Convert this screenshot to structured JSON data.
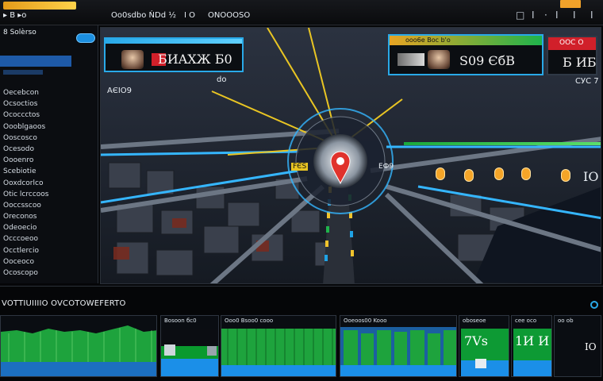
{
  "topbar": {
    "items": [
      "▸ B  ▸o",
      " ",
      "Oo0sdbo ŃDd ½",
      "I O",
      "ONOOOSO"
    ],
    "right_icons": [
      "□",
      "I",
      "·",
      "I",
      "I",
      "I",
      " "
    ]
  },
  "sidebar": {
    "title": "8 Solèrso",
    "subtitle": " ",
    "active_item": " ",
    "items": [
      "Oecebcon",
      "Ocsoctios",
      "Ococcctos",
      "Oooblgaoos",
      "Ooscosco",
      "Ocesodo",
      "Oooenro",
      "Scebiotie",
      "Ooxdcorlco",
      "Otic lcrccoos",
      "Ooccsscoo",
      "Oreconos",
      "Odeoecio",
      "Occcoeoo",
      "Occtlercio",
      "Ooceoco",
      "Ocoscopo"
    ]
  },
  "map": {
    "left_cam_text": "БИAХЖ Б0",
    "right_cam_header": "ooo6e Boс b'o",
    "right_cam_text": "S09 ЄбB",
    "right_red_header": "OOC O",
    "right_red_text": "Б ИБ",
    "label_area": "AЄІO9",
    "label_do": "do",
    "label_cc": "CУC 7",
    "label_io": "IO",
    "route_label": "FЄS",
    "route_label_right": "EФ9"
  },
  "bottom": {
    "title": "VOTTIUIIIIO OVCOTOWEFERTO",
    "cards": [
      {
        "label": " ",
        "value": ""
      },
      {
        "label": "Bosoon бc0",
        "value": ""
      },
      {
        "label": "Ooo0 Bsoo0 cooo",
        "value": ""
      },
      {
        "label": "Ooeoos00 Kooo",
        "value": ""
      },
      {
        "label": "oboseoe",
        "value": "7Vѕ"
      },
      {
        "label": "cee oco",
        "value": "1И И"
      },
      {
        "label": " ",
        "value": "IO"
      }
    ],
    "extra_label": "oo ob"
  },
  "colors": {
    "accent": "#29a9e8",
    "green": "#1aa83c",
    "red": "#d1202a",
    "orange": "#f5a528"
  }
}
